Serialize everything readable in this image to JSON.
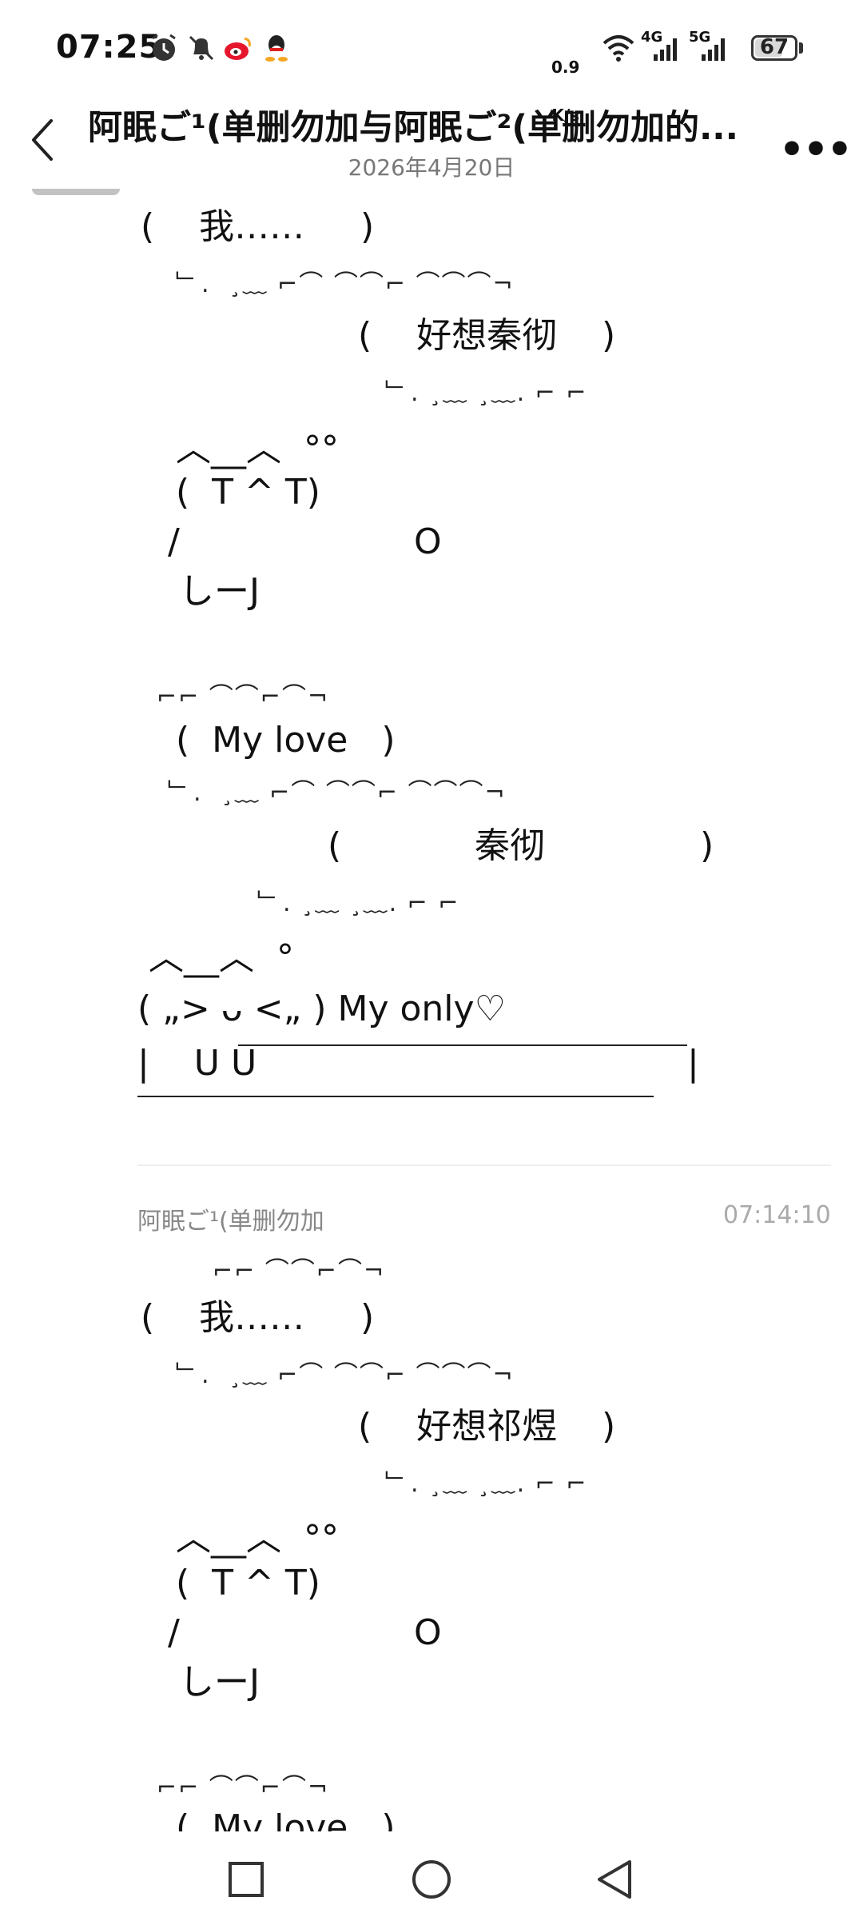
{
  "status_bar": {
    "time": "07:25",
    "net_speed_value": "0.9",
    "net_speed_unit": "K/s",
    "signal_1": "4G",
    "signal_2": "5G",
    "battery": "67",
    "icons": [
      "alarm-icon",
      "mute-bell-icon",
      "weibo-icon",
      "qq-icon",
      "wifi-icon",
      "signal-icon",
      "signal-icon",
      "battery-icon"
    ]
  },
  "header": {
    "title": "阿眠ご¹(单删勿加与阿眠ご²(单删勿加的...",
    "date": "2026年4月20日",
    "back_icon": "back-arrow-icon",
    "more_icon": "more-icon",
    "more_glyph": "•••"
  },
  "message1": {
    "speech_me": "(    我……     )",
    "thought_1": "(    好想秦彻    )",
    "face_top": "︿__︿  °°",
    "face": "(  T ^ T)",
    "arm_left": "/",
    "arm_right": "O",
    "feet": "しーJ",
    "love": "(  My love   )",
    "thought_2_open": "(",
    "thought_2_text": "秦彻",
    "thought_2_close": ")",
    "face2_top": "︿__︿  °",
    "face2": "( „> ᴗ <„ ) My only♡",
    "sign_left": "|    U U",
    "sign_right": "|"
  },
  "message2": {
    "sender": "阿眠ご¹(单删勿加",
    "time": "07:14:10",
    "speech_me": "(    我……     )",
    "thought_1": "(    好想祁煜    )",
    "face_top": "︿__︿  °°",
    "face": "(  T ^ T)",
    "arm_left": "/",
    "arm_right": "O",
    "feet": "しーJ",
    "love": "(  My love   )"
  },
  "nav": {
    "recent_icon": "square-recent-icon",
    "home_icon": "circle-home-icon",
    "back_icon": "triangle-back-icon"
  }
}
